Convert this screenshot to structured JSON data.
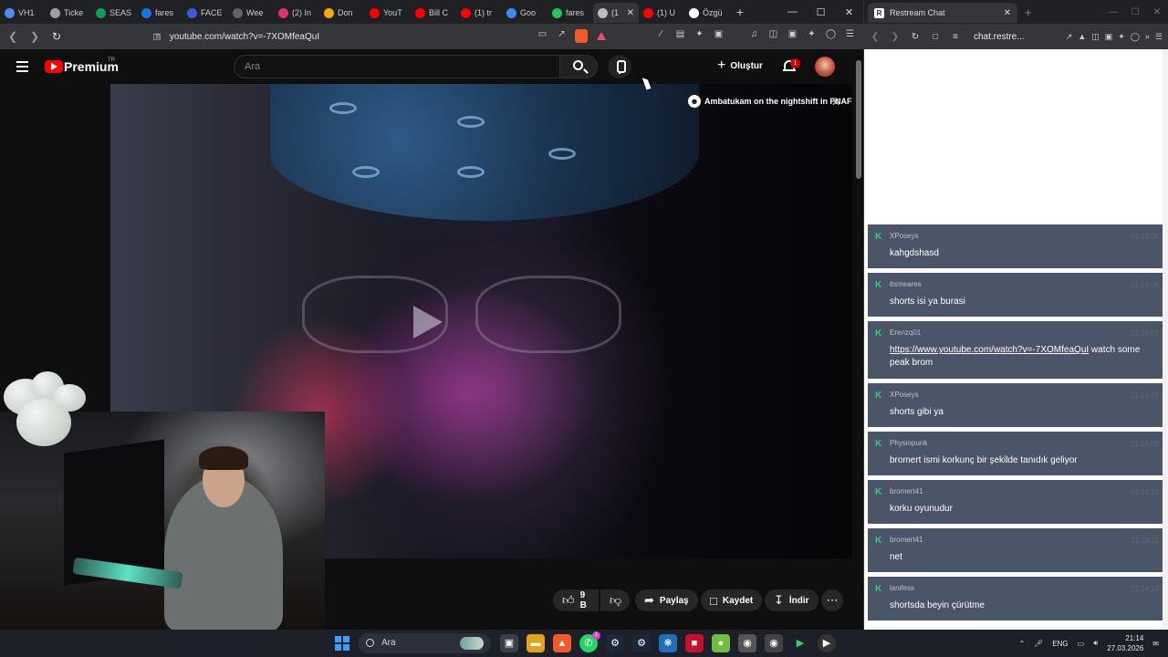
{
  "left_browser": {
    "tabs": [
      {
        "label": "VH1",
        "color": "#4c8bf5"
      },
      {
        "label": "Ticke",
        "color": "#9aa0a6"
      },
      {
        "label": "SEAS",
        "color": "#0f9d58"
      },
      {
        "label": "fares",
        "color": "#1a73e8"
      },
      {
        "label": "FACE",
        "color": "#3b5bdb"
      },
      {
        "label": "Wee",
        "color": "#5f6368"
      },
      {
        "label": "(2) In",
        "color": "#e1306c"
      },
      {
        "label": "Don",
        "color": "#f2a900"
      },
      {
        "label": "YouT",
        "color": "#ff0000"
      },
      {
        "label": "Bill C",
        "color": "#ff0000"
      },
      {
        "label": "(1) tr",
        "color": "#ff0000"
      },
      {
        "label": "Goo",
        "color": "#4285f4"
      },
      {
        "label": "fares",
        "color": "#22c55e"
      },
      {
        "label": "(1",
        "color": "#bbbbbb",
        "active": true
      },
      {
        "label": "(1) U",
        "color": "#ff0000"
      },
      {
        "label": "Özgü",
        "color": "#ffffff"
      }
    ],
    "active_tab_close": "✕",
    "new_tab": "+",
    "window_controls": {
      "minimize": "—",
      "maximize": "☐",
      "close": "✕"
    },
    "url": "youtube.com/watch?v=-7XOMfeaQuI"
  },
  "youtube": {
    "brand": "Premium",
    "region": "TR",
    "search_placeholder": "Ara",
    "create_label": "Oluştur",
    "notification_count": "1",
    "overlay_title": "Ambatukam on the nightshift in FNAF",
    "like_count": "9 B",
    "share_label": "Paylaş",
    "save_label": "Kaydet",
    "download_label": "İndir"
  },
  "right_browser": {
    "tab_title": "Restream Chat",
    "tab_favicon": "R",
    "url": "chat.restre...",
    "chat_messages": [
      {
        "user": "XPoseys",
        "time": "21:14:04",
        "text": "kahgdshasd"
      },
      {
        "user": "itsmeares",
        "time": "21:14:05",
        "text": "shorts isi ya burasi"
      },
      {
        "user": "Erenzq01",
        "time": "21:14:07",
        "link": "https://www.youtube.com/watch?v=-7XOMfeaQuI",
        "text": " watch some peak brom"
      },
      {
        "user": "XPoseys",
        "time": "21:14:07",
        "text": "shorts gibi ya"
      },
      {
        "user": "Physiopunk",
        "time": "21:14:09",
        "text": "bromert ismi korkunç bir şekilde tanıdık geliyor"
      },
      {
        "user": "bromert41",
        "time": "21:14:10",
        "text": "korku oyunudur"
      },
      {
        "user": "bromert41",
        "time": "21:14:11",
        "text": "net"
      },
      {
        "user": "lanifess",
        "time": "21:14:13",
        "text": "shortsda beyin çürütme"
      }
    ]
  },
  "taskbar": {
    "search_label": "Ara",
    "language": "ENG",
    "time": "21:14",
    "date": "27.03.2026",
    "badge": "1"
  }
}
